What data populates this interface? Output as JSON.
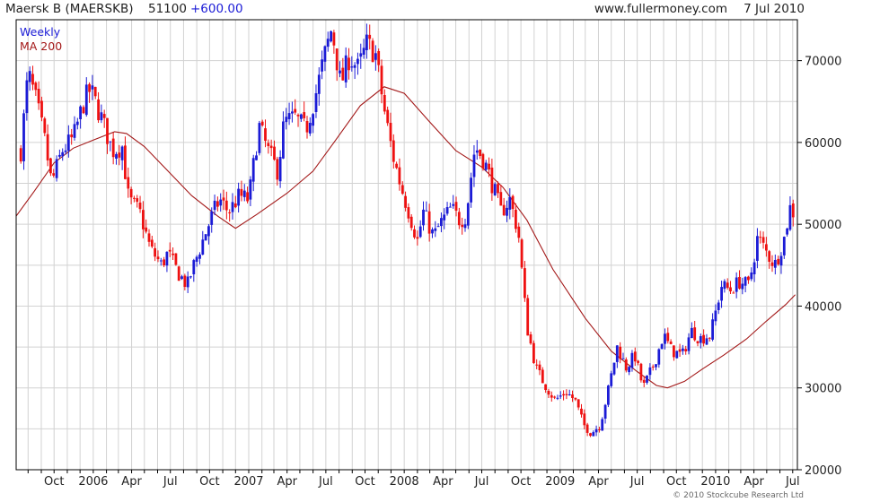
{
  "header": {
    "ticker": "Maersk B (MAERSKB)",
    "last": "51100",
    "change": "+600.00",
    "site": "www.fullermoney.com",
    "date": "7 Jul 2010"
  },
  "copyright": "© 2010 Stockcube Research Ltd",
  "colors": {
    "up": "#1b1bd6",
    "down": "#ee1111",
    "ma": "#a31818",
    "grid": "#d2d2d2",
    "axis": "#000000"
  },
  "chart_data": {
    "type": "candlestick",
    "legend": [
      {
        "name": "Weekly",
        "color": "#1b1bd6"
      },
      {
        "name": "MA 200",
        "color": "#a31818"
      }
    ],
    "legend_position": "top-left",
    "grid": true,
    "yaxis_side": "right",
    "ylim": [
      20000,
      75000
    ],
    "y_ticks": [
      {
        "value": 20000,
        "label": "20000"
      },
      {
        "value": 30000,
        "label": "30000"
      },
      {
        "value": 40000,
        "label": "40000"
      },
      {
        "value": 50000,
        "label": "50000"
      },
      {
        "value": 60000,
        "label": "60000"
      },
      {
        "value": 70000,
        "label": "70000"
      }
    ],
    "xlim": [
      "2005-07-04",
      "2010-07-12"
    ],
    "x_ticks": [
      {
        "date": "2005-10-01",
        "label": "Oct"
      },
      {
        "date": "2006-01-01",
        "label": "2006"
      },
      {
        "date": "2006-04-01",
        "label": "Apr"
      },
      {
        "date": "2006-07-01",
        "label": "Jul"
      },
      {
        "date": "2006-10-01",
        "label": "Oct"
      },
      {
        "date": "2007-01-01",
        "label": "2007"
      },
      {
        "date": "2007-04-01",
        "label": "Apr"
      },
      {
        "date": "2007-07-01",
        "label": "Jul"
      },
      {
        "date": "2007-10-01",
        "label": "Oct"
      },
      {
        "date": "2008-01-01",
        "label": "2008"
      },
      {
        "date": "2008-04-01",
        "label": "Apr"
      },
      {
        "date": "2008-07-01",
        "label": "Jul"
      },
      {
        "date": "2008-10-01",
        "label": "Oct"
      },
      {
        "date": "2009-01-01",
        "label": "2009"
      },
      {
        "date": "2009-04-01",
        "label": "Apr"
      },
      {
        "date": "2009-07-01",
        "label": "Jul"
      },
      {
        "date": "2009-10-01",
        "label": "Oct"
      },
      {
        "date": "2010-01-01",
        "label": "2010"
      },
      {
        "date": "2010-04-01",
        "label": "Apr"
      },
      {
        "date": "2010-07-01",
        "label": "Jul"
      }
    ],
    "weekly_close_path": [
      [
        "2005-07-15",
        59000
      ],
      [
        "2005-08-01",
        68500
      ],
      [
        "2005-08-20",
        65000
      ],
      [
        "2005-09-10",
        60000
      ],
      [
        "2005-09-25",
        55000
      ],
      [
        "2005-10-20",
        59000
      ],
      [
        "2005-11-15",
        60500
      ],
      [
        "2005-12-10",
        65000
      ],
      [
        "2005-12-25",
        66500
      ],
      [
        "2006-01-20",
        63000
      ],
      [
        "2006-02-15",
        59000
      ],
      [
        "2006-03-10",
        59500
      ],
      [
        "2006-03-25",
        53000
      ],
      [
        "2006-04-20",
        51500
      ],
      [
        "2006-05-15",
        47000
      ],
      [
        "2006-06-10",
        45000
      ],
      [
        "2006-06-25",
        46500
      ],
      [
        "2006-07-20",
        44000
      ],
      [
        "2006-08-10",
        42500
      ],
      [
        "2006-08-25",
        45000
      ],
      [
        "2006-09-15",
        48000
      ],
      [
        "2006-10-10",
        51500
      ],
      [
        "2006-10-25",
        53000
      ],
      [
        "2006-11-15",
        51500
      ],
      [
        "2006-12-10",
        53500
      ],
      [
        "2007-01-01",
        53000
      ],
      [
        "2007-01-25",
        62000
      ],
      [
        "2007-02-15",
        59000
      ],
      [
        "2007-03-10",
        56500
      ],
      [
        "2007-03-25",
        62500
      ],
      [
        "2007-04-20",
        63000
      ],
      [
        "2007-05-15",
        61500
      ],
      [
        "2007-06-10",
        66500
      ],
      [
        "2007-06-25",
        70000
      ],
      [
        "2007-07-15",
        74000
      ],
      [
        "2007-08-05",
        67000
      ],
      [
        "2007-08-25",
        70500
      ],
      [
        "2007-09-15",
        69000
      ],
      [
        "2007-10-05",
        72000
      ],
      [
        "2007-10-25",
        71000
      ],
      [
        "2007-11-15",
        64000
      ],
      [
        "2007-12-05",
        58500
      ],
      [
        "2007-12-25",
        54500
      ],
      [
        "2008-01-15",
        51000
      ],
      [
        "2008-02-01",
        48000
      ],
      [
        "2008-02-15",
        51500
      ],
      [
        "2008-03-10",
        48500
      ],
      [
        "2008-03-25",
        50000
      ],
      [
        "2008-04-20",
        52000
      ],
      [
        "2008-05-10",
        50500
      ],
      [
        "2008-05-25",
        51000
      ],
      [
        "2008-06-15",
        59500
      ],
      [
        "2008-07-05",
        58000
      ],
      [
        "2008-07-25",
        55000
      ],
      [
        "2008-08-15",
        51500
      ],
      [
        "2008-09-05",
        53000
      ],
      [
        "2008-09-25",
        49000
      ],
      [
        "2008-10-15",
        37500
      ],
      [
        "2008-11-05",
        32500
      ],
      [
        "2008-11-25",
        30500
      ],
      [
        "2008-12-20",
        28500
      ],
      [
        "2009-01-15",
        29500
      ],
      [
        "2009-02-05",
        28500
      ],
      [
        "2009-02-25",
        25500
      ],
      [
        "2009-03-15",
        24500
      ],
      [
        "2009-04-05",
        25500
      ],
      [
        "2009-04-25",
        30000
      ],
      [
        "2009-05-15",
        35000
      ],
      [
        "2009-06-05",
        32500
      ],
      [
        "2009-06-25",
        34000
      ],
      [
        "2009-07-15",
        30000
      ],
      [
        "2009-08-10",
        33000
      ],
      [
        "2009-09-01",
        36500
      ],
      [
        "2009-09-20",
        34500
      ],
      [
        "2009-10-15",
        34000
      ],
      [
        "2009-11-05",
        37000
      ],
      [
        "2009-11-25",
        36000
      ],
      [
        "2009-12-20",
        36500
      ],
      [
        "2010-01-15",
        42500
      ],
      [
        "2010-02-05",
        42000
      ],
      [
        "2010-02-25",
        43000
      ],
      [
        "2010-03-20",
        42500
      ],
      [
        "2010-04-10",
        48500
      ],
      [
        "2010-05-01",
        46500
      ],
      [
        "2010-05-20",
        45000
      ],
      [
        "2010-06-10",
        48000
      ],
      [
        "2010-06-25",
        52000
      ],
      [
        "2010-07-07",
        51100
      ]
    ],
    "ma_200": [
      [
        "2005-07-04",
        51000
      ],
      [
        "2005-08-15",
        54000
      ],
      [
        "2005-10-01",
        57500
      ],
      [
        "2005-11-15",
        59300
      ],
      [
        "2006-01-01",
        60300
      ],
      [
        "2006-02-20",
        61300
      ],
      [
        "2006-03-20",
        61100
      ],
      [
        "2006-05-01",
        59500
      ],
      [
        "2006-06-20",
        56800
      ],
      [
        "2006-08-20",
        53500
      ],
      [
        "2006-10-20",
        51000
      ],
      [
        "2006-12-01",
        49500
      ],
      [
        "2007-01-20",
        51200
      ],
      [
        "2007-04-01",
        53800
      ],
      [
        "2007-06-01",
        56500
      ],
      [
        "2007-07-20",
        60000
      ],
      [
        "2007-09-20",
        64500
      ],
      [
        "2007-11-15",
        66800
      ],
      [
        "2008-01-01",
        66000
      ],
      [
        "2008-03-01",
        62500
      ],
      [
        "2008-05-01",
        59000
      ],
      [
        "2008-07-01",
        57000
      ],
      [
        "2008-08-20",
        54500
      ],
      [
        "2008-10-15",
        50500
      ],
      [
        "2008-12-15",
        44500
      ],
      [
        "2009-03-01",
        38500
      ],
      [
        "2009-05-01",
        34500
      ],
      [
        "2009-07-01",
        32000
      ],
      [
        "2009-08-15",
        30300
      ],
      [
        "2009-09-10",
        30000
      ],
      [
        "2009-10-20",
        30800
      ],
      [
        "2009-12-01",
        32300
      ],
      [
        "2010-01-20",
        34000
      ],
      [
        "2010-03-15",
        36000
      ],
      [
        "2010-05-01",
        38200
      ],
      [
        "2010-06-15",
        40200
      ],
      [
        "2010-07-07",
        41400
      ]
    ]
  }
}
